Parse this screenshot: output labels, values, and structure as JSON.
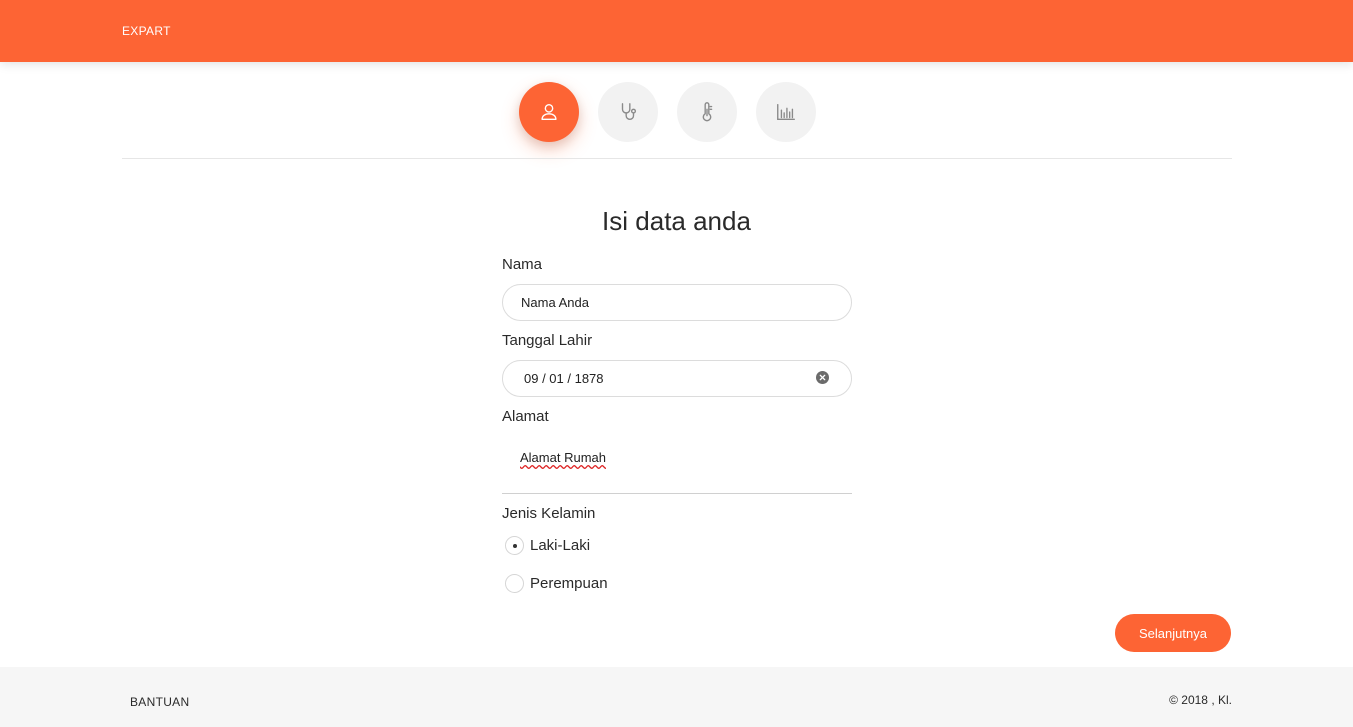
{
  "header": {
    "brand": "EXPART"
  },
  "steps": [
    {
      "icon": "user-icon",
      "active": true
    },
    {
      "icon": "stethoscope-icon",
      "active": false
    },
    {
      "icon": "thermometer-icon",
      "active": false
    },
    {
      "icon": "bar-chart-icon",
      "active": false
    }
  ],
  "form": {
    "title": "Isi data anda",
    "name_label": "Nama",
    "name_value": "Nama Anda",
    "birthdate_label": "Tanggal Lahir",
    "birthdate_value": "09 / 01 / 1878",
    "address_label": "Alamat",
    "address_value": "Alamat Rumah",
    "gender_label": "Jenis Kelamin",
    "gender_options": [
      {
        "label": "Laki-Laki",
        "selected": true
      },
      {
        "label": "Perempuan",
        "selected": false
      }
    ],
    "next_button": "Selanjutnya"
  },
  "footer": {
    "help": "BANTUAN",
    "copyright": "© 2018 , Kl."
  },
  "colors": {
    "accent": "#fd6434",
    "step_inactive_bg": "#f2f2f2",
    "footer_bg": "#f6f6f6"
  }
}
